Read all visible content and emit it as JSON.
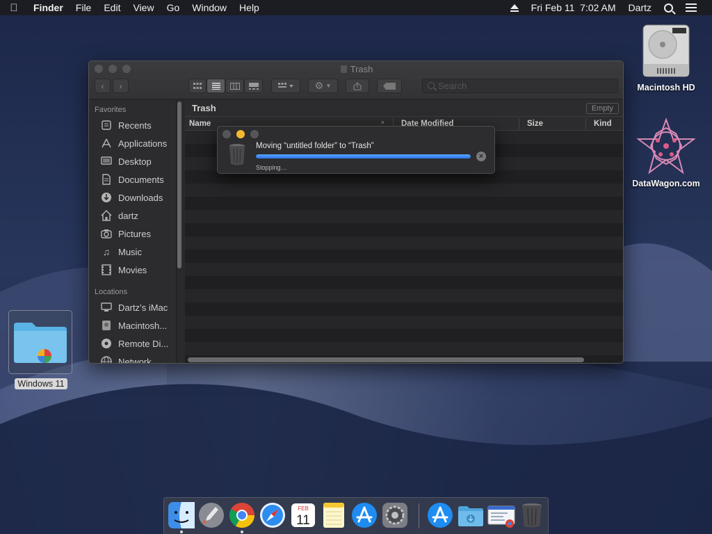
{
  "menubar": {
    "app_name": "Finder",
    "menus": [
      "File",
      "Edit",
      "View",
      "Go",
      "Window",
      "Help"
    ],
    "datetime": "Fri Feb 11  7:02 AM",
    "user": "Dartz"
  },
  "desktop": {
    "hd_label": "Macintosh HD",
    "site_label": "DataWagon.com",
    "folder_label": "Windows 11"
  },
  "finder": {
    "title": "Trash",
    "search_placeholder": "Search",
    "path_title": "Trash",
    "empty_label": "Empty",
    "columns": {
      "name": "Name",
      "date": "Date Modified",
      "size": "Size",
      "kind": "Kind"
    },
    "favorites_header": "Favorites",
    "favorites": [
      {
        "label": "Recents",
        "icon": "recents-icon"
      },
      {
        "label": "Applications",
        "icon": "applications-icon"
      },
      {
        "label": "Desktop",
        "icon": "desktop-icon"
      },
      {
        "label": "Documents",
        "icon": "documents-icon"
      },
      {
        "label": "Downloads",
        "icon": "downloads-icon"
      },
      {
        "label": "dartz",
        "icon": "home-icon"
      },
      {
        "label": "Pictures",
        "icon": "pictures-icon"
      },
      {
        "label": "Music",
        "icon": "music-icon"
      },
      {
        "label": "Movies",
        "icon": "movies-icon"
      }
    ],
    "locations_header": "Locations",
    "locations": [
      {
        "label": "Dartz’s iMac",
        "icon": "imac-icon"
      },
      {
        "label": "Macintosh...",
        "icon": "disk-icon"
      },
      {
        "label": "Remote Di...",
        "icon": "remote-disc-icon"
      },
      {
        "label": "Network",
        "icon": "network-icon"
      }
    ]
  },
  "dialog": {
    "title": "Moving “untitled folder” to “Trash”",
    "status": "Stopping…",
    "progress": 1.0
  },
  "dock": {
    "apps": [
      "Finder",
      "Launchpad",
      "Chrome",
      "Safari",
      "Calendar",
      "Notes",
      "App Store",
      "System Preferences",
      "App Store",
      "Downloads",
      "Chrome Window",
      "Trash"
    ],
    "calendar_month": "FEB",
    "calendar_day": "11"
  },
  "colors": {
    "accent": "#2a72e6",
    "minimize": "#f5b82e"
  }
}
